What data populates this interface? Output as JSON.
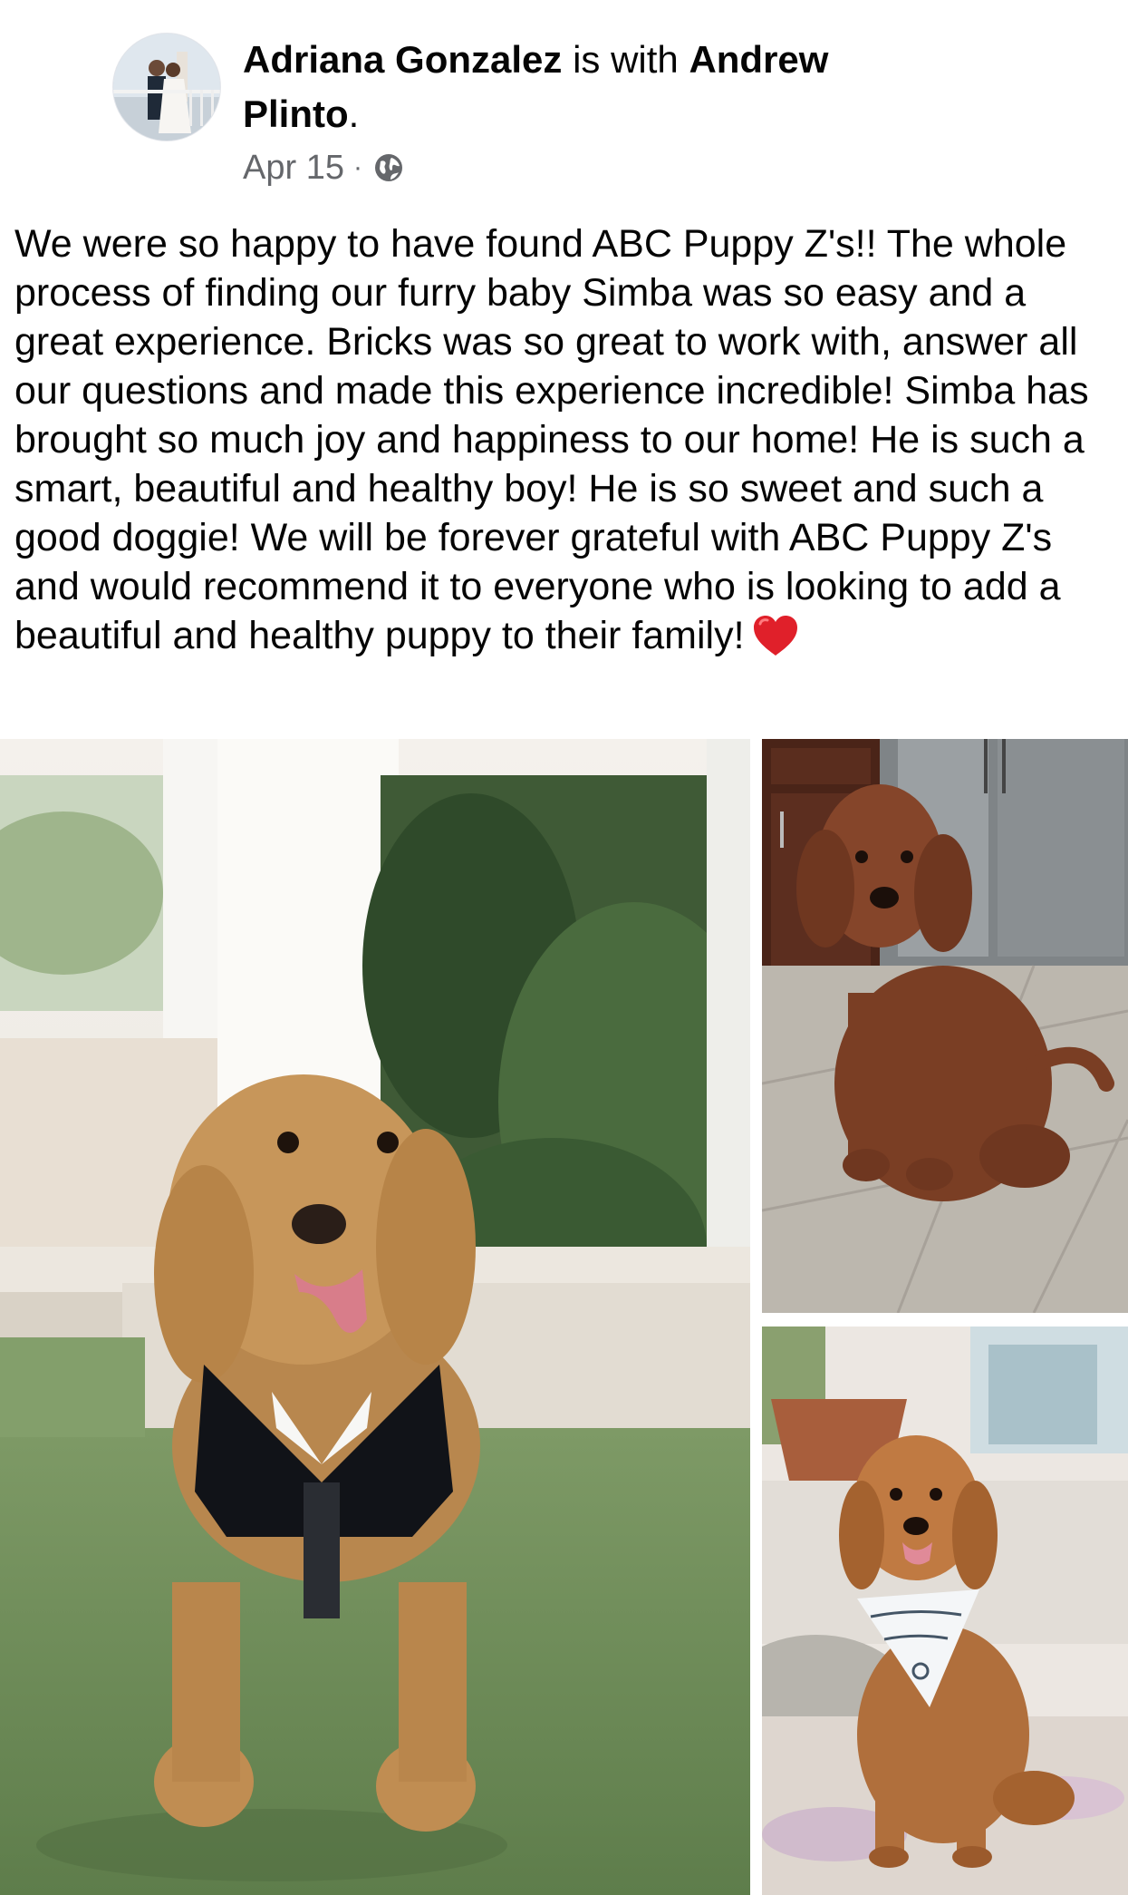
{
  "post": {
    "author": "Adriana Gonzalez",
    "with_text": " is with ",
    "tagged": "Andrew Plinto",
    "period": ".",
    "date": "Apr 15",
    "separator": "·",
    "privacy_icon": "globe-icon",
    "text": "We were so happy to have found ABC Puppy Z's!! The whole process of finding our furry baby Simba was so easy and a great experience. Bricks was so great to work with, answer all our questions and made this experience incredible! Simba has brought so much joy and happiness to our home! He is such a smart, beautiful and healthy boy! He is so sweet and such a good doggie! We will be forever grateful with ABC Puppy Z's and would recommend it to everyone who is looking to add a beautiful and healthy puppy to their family!",
    "emoji": "red-heart-emoji"
  },
  "photos": {
    "main_icon": "dog-in-tuxedo-photo",
    "top_right_icon": "dog-sitting-kitchen-photo",
    "bottom_right_icon": "dog-with-bandana-photo"
  },
  "colors": {
    "text_primary": "#050505",
    "text_secondary": "#65676b",
    "heart": "#e0202a",
    "grass": "#6f8f58"
  }
}
